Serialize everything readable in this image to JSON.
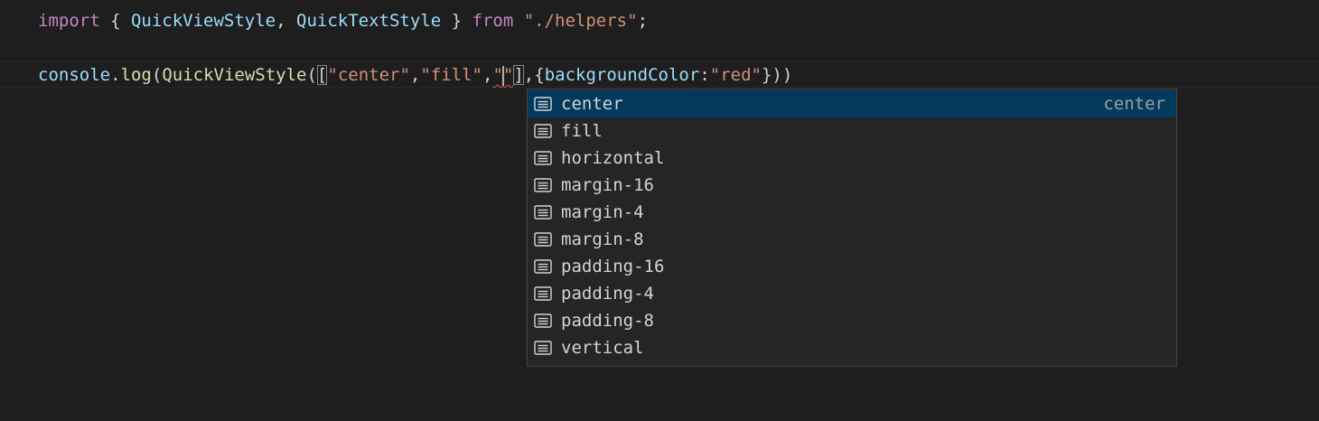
{
  "editor": {
    "line1": {
      "kw_import": "import",
      "open_brace": " { ",
      "ident1": "QuickViewStyle",
      "comma": ", ",
      "ident2": "QuickTextStyle",
      "close_brace": " } ",
      "kw_from": "from",
      "space": " ",
      "module": "\"./helpers\"",
      "semi": ";"
    },
    "line3": {
      "obj": "console",
      "dot": ".",
      "method": "log",
      "paren_open": "(",
      "func": "QuickViewStyle",
      "paren_open2": "(",
      "bracket_open": "[",
      "str1": "\"center\"",
      "comma1": ",",
      "str2": "\"fill\"",
      "comma2": ",",
      "str3_open": "\"",
      "str3_close": "\"",
      "bracket_close": "]",
      "comma3": ",",
      "obj_open": "{",
      "prop": "backgroundColor",
      "colon": ":",
      "str4": "\"red\"",
      "tail": "}))"
    }
  },
  "suggest": {
    "icon": "text-lines-icon",
    "selected_detail": "center",
    "items": [
      {
        "label": "center"
      },
      {
        "label": "fill"
      },
      {
        "label": "horizontal"
      },
      {
        "label": "margin-16"
      },
      {
        "label": "margin-4"
      },
      {
        "label": "margin-8"
      },
      {
        "label": "padding-16"
      },
      {
        "label": "padding-4"
      },
      {
        "label": "padding-8"
      },
      {
        "label": "vertical"
      }
    ]
  },
  "colors": {
    "background": "#1e1e1e",
    "keyword": "#c586c0",
    "identifier": "#9cdcfe",
    "function": "#dcdcaa",
    "string": "#ce9178",
    "suggest_bg": "#252526",
    "suggest_selected": "#04395e",
    "error_squiggle": "#f14c4c"
  }
}
